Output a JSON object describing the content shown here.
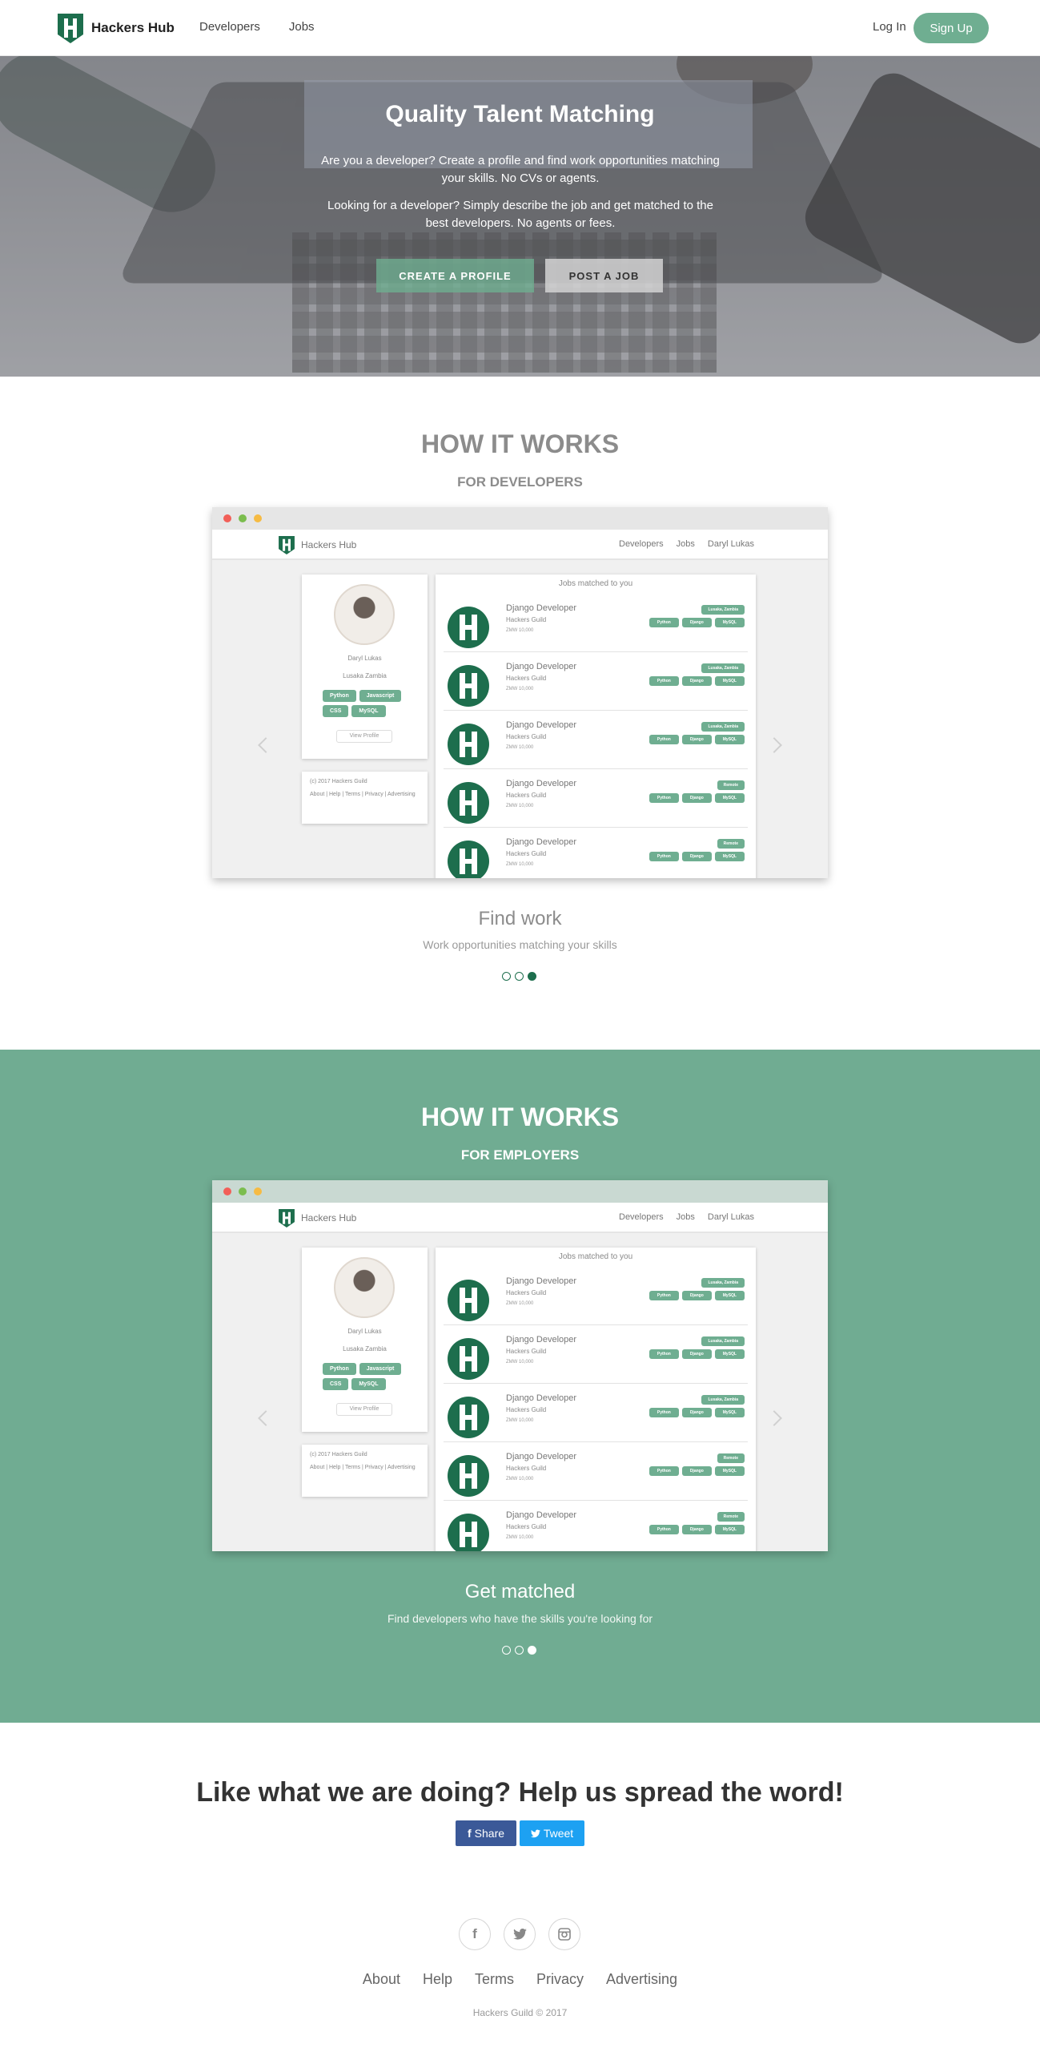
{
  "navbar": {
    "brand": "Hackers Hub",
    "links": [
      "Developers",
      "Jobs"
    ],
    "login": "Log In",
    "signup": "Sign Up"
  },
  "hero": {
    "title": "Quality Talent Matching",
    "developer_text": "Are you a developer? Create a profile and find work opportunities matching your skills. No CVs or agents.",
    "employer_text": "Looking for a developer? Simply describe the job and get matched to the best developers. No agents or fees.",
    "create_profile": "CREATE A PROFILE",
    "post_job": "POST A JOB"
  },
  "developers_section": {
    "title": "HOW IT WORKS",
    "subtitle": "FOR DEVELOPERS",
    "caption": "Find work",
    "text": "Work opportunities matching your skills",
    "active_slide": 3,
    "slide_count": 3
  },
  "employers_section": {
    "title": "HOW IT WORKS",
    "subtitle": "FOR EMPLOYERS",
    "caption": "Get matched",
    "text": "Find developers who have the skills you're looking for",
    "active_slide": 3,
    "slide_count": 3
  },
  "mock": {
    "brand": "Hackers Hub",
    "links": [
      "Developers",
      "Jobs",
      "Daryl Lukas"
    ],
    "profile_name": "Daryl Lukas",
    "profile_location": "Lusaka Zambia",
    "profile_tags": [
      "Python",
      "Javascript",
      "CSS",
      "MySQL"
    ],
    "view_profile": "View Profile",
    "footer_copy": "(c) 2017 Hackers Guild",
    "footer_links": "About | Help | Terms | Privacy | Advertising",
    "jobs_heading": "Jobs matched to you",
    "jobs": [
      {
        "title": "Django Developer",
        "company": "Hackers Guild",
        "salary": "ZMW 10,000",
        "location": "Lusaka, Zambia",
        "tags": [
          "Python",
          "Django",
          "MySQL"
        ]
      },
      {
        "title": "Django Developer",
        "company": "Hackers Guild",
        "salary": "ZMW 10,000",
        "location": "Lusaka, Zambia",
        "tags": [
          "Python",
          "Django",
          "MySQL"
        ]
      },
      {
        "title": "Django Developer",
        "company": "Hackers Guild",
        "salary": "ZMW 10,000",
        "location": "Lusaka, Zambia",
        "tags": [
          "Python",
          "Django",
          "MySQL"
        ]
      },
      {
        "title": "Django Developer",
        "company": "Hackers Guild",
        "salary": "ZMW 10,000",
        "location": "Remote",
        "tags": [
          "Python",
          "Django",
          "MySQL"
        ]
      },
      {
        "title": "Django Developer",
        "company": "Hackers Guild",
        "salary": "ZMW 10,000",
        "location": "Remote",
        "tags": [
          "Python",
          "Django",
          "MySQL"
        ]
      }
    ]
  },
  "share": {
    "title": "Like what we are doing? Help us spread the word!",
    "facebook": "Share",
    "twitter": "Tweet"
  },
  "footer": {
    "social_icons": [
      "facebook-icon",
      "twitter-icon",
      "instagram-icon"
    ],
    "links": [
      "About",
      "Help",
      "Terms",
      "Privacy",
      "Advertising"
    ],
    "copyright": "Hackers Guild © 2017"
  },
  "colors": {
    "accent": "#6fae91",
    "band": "#70ac92",
    "brand_dark": "#1d6e4d",
    "facebook": "#3b5998",
    "twitter": "#1da1f2"
  }
}
